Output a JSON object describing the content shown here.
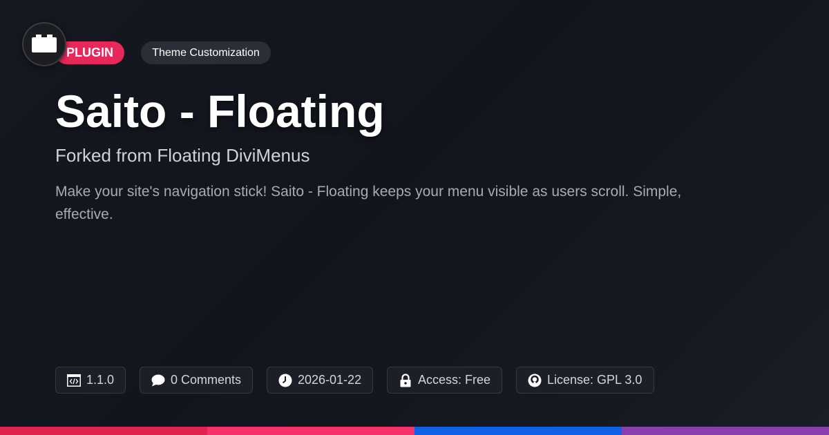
{
  "badges": {
    "type": "PLUGIN",
    "category": "Theme Customization"
  },
  "title": "Saito - Floating",
  "subtitle": "Forked from Floating DiviMenus",
  "description": "Make your site's navigation stick! Saito - Floating keeps your menu visible as users scroll. Simple, effective.",
  "meta": {
    "version": "1.1.0",
    "comments": "0 Comments",
    "date": "2026-01-22",
    "access": "Access: Free",
    "license": "License: GPL 3.0"
  },
  "icons": {
    "logo": "plugin-icon",
    "version": "code-icon",
    "comments": "speech-bubble-icon",
    "date": "clock-icon",
    "access": "lock-icon",
    "license": "open-source-icon"
  },
  "colors": {
    "accent": "#e8285a",
    "bar": [
      "#e0244f",
      "#f5336a",
      "#0f62e8",
      "#8a3fae"
    ]
  }
}
